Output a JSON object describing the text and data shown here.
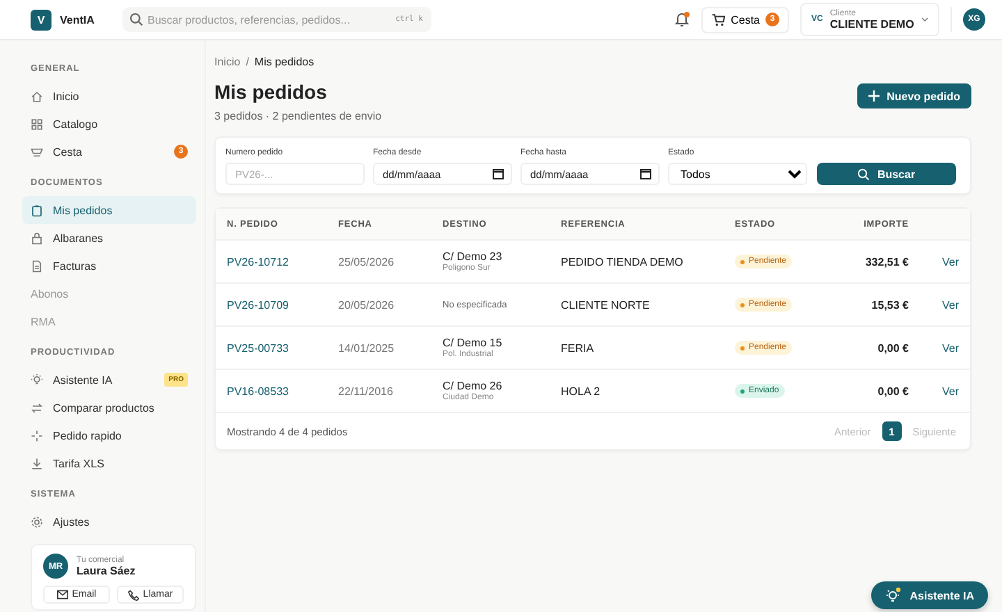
{
  "brand": {
    "logo": "V",
    "name": "VentIA"
  },
  "search": {
    "placeholder": "Buscar productos, referencias, pedidos...",
    "shortcut": "ctrl k"
  },
  "header": {
    "notifications_unread": true,
    "cart": {
      "label": "Cesta",
      "count": "3"
    },
    "client": {
      "initials": "VC",
      "caption": "Cliente",
      "name": "CLIENTE DEMO"
    },
    "user_initials": "XG"
  },
  "sidebar": {
    "sections": [
      {
        "title": "GENERAL",
        "items": [
          {
            "label": "Inicio",
            "selected": false,
            "disabled": false
          },
          {
            "label": "Catalogo",
            "selected": false,
            "disabled": false
          },
          {
            "label": "Cesta",
            "selected": false,
            "disabled": false,
            "badge": {
              "text": "3",
              "kind": "count"
            }
          }
        ]
      },
      {
        "title": "DOCUMENTOS",
        "items": [
          {
            "label": "Mis pedidos",
            "selected": true,
            "disabled": false
          },
          {
            "label": "Albaranes",
            "selected": false,
            "disabled": false
          },
          {
            "label": "Facturas",
            "selected": false,
            "disabled": false
          },
          {
            "label": "Abonos",
            "selected": false,
            "disabled": true
          },
          {
            "label": "RMA",
            "selected": false,
            "disabled": true
          }
        ]
      },
      {
        "title": "PRODUCTIVIDAD",
        "items": [
          {
            "label": "Asistente IA",
            "selected": false,
            "disabled": false,
            "badge": {
              "text": "PRO",
              "kind": "tag"
            }
          },
          {
            "label": "Comparar productos",
            "selected": false,
            "disabled": false
          },
          {
            "label": "Pedido rapido",
            "selected": false,
            "disabled": false
          },
          {
            "label": "Tarifa XLS",
            "selected": false,
            "disabled": false
          }
        ]
      },
      {
        "title": "SISTEMA",
        "items": [
          {
            "label": "Ajustes",
            "selected": false,
            "disabled": false
          }
        ]
      }
    ]
  },
  "comercial": {
    "initials": "MR",
    "caption": "Tu comercial",
    "name": "Laura Sáez",
    "buttons": [
      {
        "label": "Email",
        "kind": "email"
      },
      {
        "label": "Llamar",
        "kind": "phone"
      }
    ]
  },
  "breadcrumb": {
    "items": [
      "Inicio",
      "Mis pedidos"
    ],
    "separator": "/"
  },
  "page": {
    "title": "Mis pedidos",
    "subtitle": "3 pedidos · 2 pendientes de envio",
    "new_button": "Nuevo pedido"
  },
  "filters": {
    "order": {
      "label": "Numero pedido",
      "placeholder": "PV26-..."
    },
    "from": {
      "label": "Fecha desde",
      "value": "dd/mm/aaaa"
    },
    "to": {
      "label": "Fecha hasta",
      "value": "dd/mm/aaaa"
    },
    "status": {
      "label": "Estado",
      "value": "Todos"
    },
    "button": "Buscar"
  },
  "table": {
    "columns": [
      "N. PEDIDO",
      "FECHA",
      "DESTINO",
      "REFERENCIA",
      "ESTADO",
      "IMPORTE"
    ],
    "rows": [
      {
        "order": "PV26-10712",
        "date": "25/05/2026",
        "destination": "C/ Demo 23",
        "destination_detail": "Poligono Sur",
        "reference": "PEDIDO TIENDA DEMO",
        "status": {
          "label": "Pendiente",
          "kind": "pending"
        },
        "amount": "332,51 €",
        "action": "Ver"
      },
      {
        "order": "PV26-10709",
        "date": "20/05/2026",
        "destination": "No especificada",
        "reference": "CLIENTE NORTE",
        "status": {
          "label": "Pendiente",
          "kind": "pending"
        },
        "amount": "15,53 €",
        "action": "Ver"
      },
      {
        "order": "PV25-00733",
        "date": "14/01/2025",
        "destination": "C/ Demo 15",
        "destination_detail": "Pol. Industrial",
        "reference": "FERIA",
        "status": {
          "label": "Pendiente",
          "kind": "pending"
        },
        "amount": "0,00 €",
        "action": "Ver"
      },
      {
        "order": "PV16-08533",
        "date": "22/11/2016",
        "destination": "C/ Demo 26",
        "destination_detail": "Ciudad Demo",
        "reference": "HOLA 2",
        "status": {
          "label": "Enviado",
          "kind": "sent"
        },
        "amount": "0,00 €",
        "action": "Ver"
      }
    ]
  },
  "footer": {
    "summary": "Mostrando 4 de 4 pedidos",
    "prev": {
      "label": "Anterior",
      "disabled": true
    },
    "pages": [
      {
        "label": "1",
        "selected": true
      }
    ],
    "next": {
      "label": "Siguiente",
      "disabled": true
    }
  },
  "assistant_button": "Asistente IA"
}
